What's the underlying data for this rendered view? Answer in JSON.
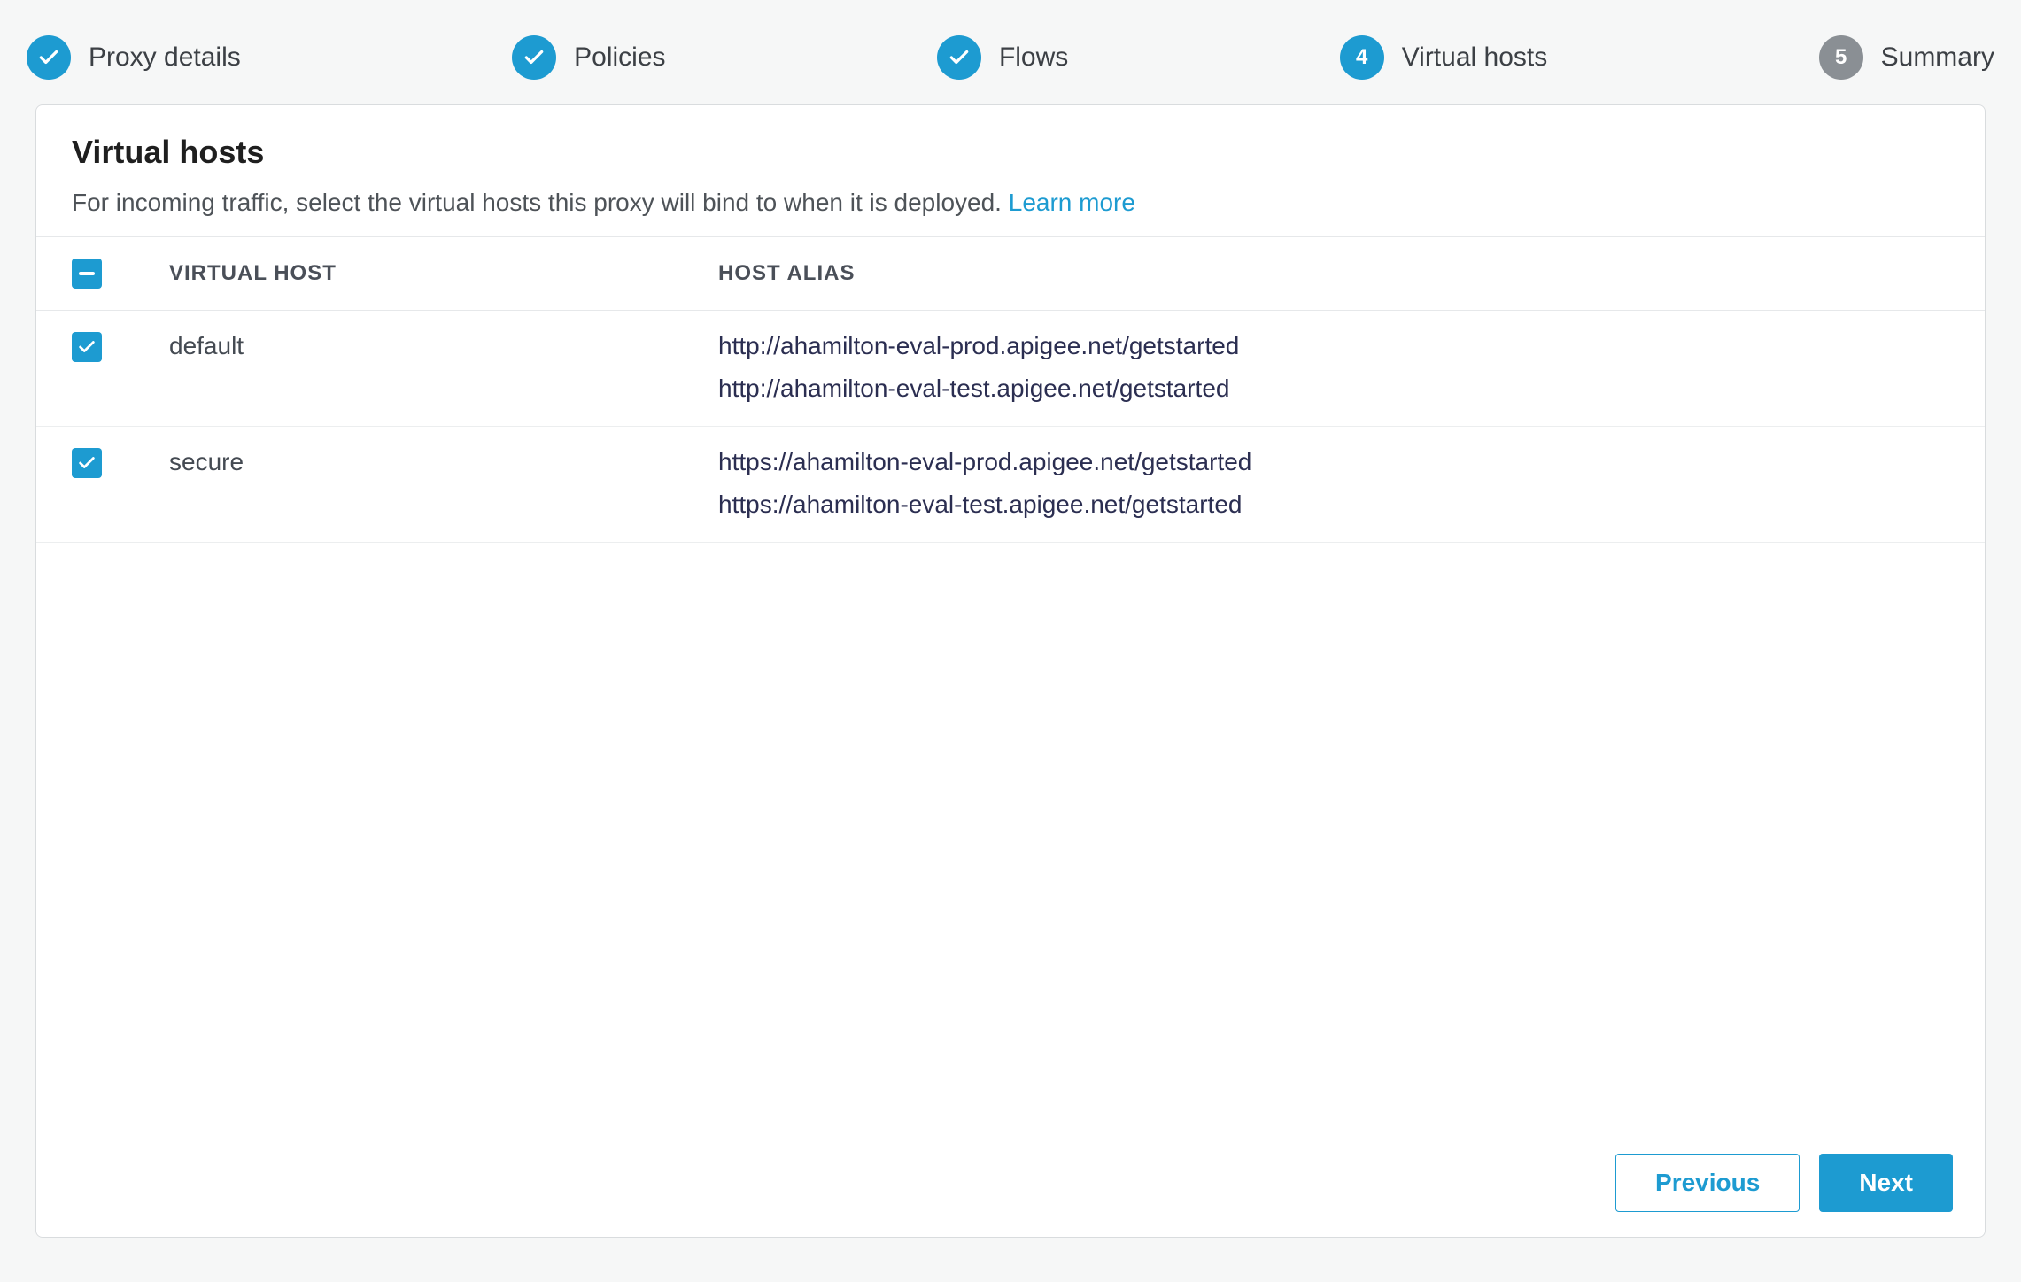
{
  "stepper": {
    "steps": [
      {
        "label": "Proxy details",
        "state": "done",
        "num": "1"
      },
      {
        "label": "Policies",
        "state": "done",
        "num": "2"
      },
      {
        "label": "Flows",
        "state": "done",
        "num": "3"
      },
      {
        "label": "Virtual hosts",
        "state": "active",
        "num": "4"
      },
      {
        "label": "Summary",
        "state": "pending",
        "num": "5"
      }
    ]
  },
  "page": {
    "title": "Virtual hosts",
    "description_prefix": "For incoming traffic, select the virtual hosts this proxy will bind to when it is deployed. ",
    "learn_more": "Learn more"
  },
  "table": {
    "header_checkbox_state": "indeterminate",
    "columns": {
      "name": "VIRTUAL HOST",
      "alias": "HOST ALIAS"
    },
    "rows": [
      {
        "name": "default",
        "checked": true,
        "aliases": [
          "http://ahamilton-eval-prod.apigee.net/getstarted",
          "http://ahamilton-eval-test.apigee.net/getstarted"
        ]
      },
      {
        "name": "secure",
        "checked": true,
        "aliases": [
          "https://ahamilton-eval-prod.apigee.net/getstarted",
          "https://ahamilton-eval-test.apigee.net/getstarted"
        ]
      }
    ]
  },
  "buttons": {
    "previous": "Previous",
    "next": "Next"
  }
}
